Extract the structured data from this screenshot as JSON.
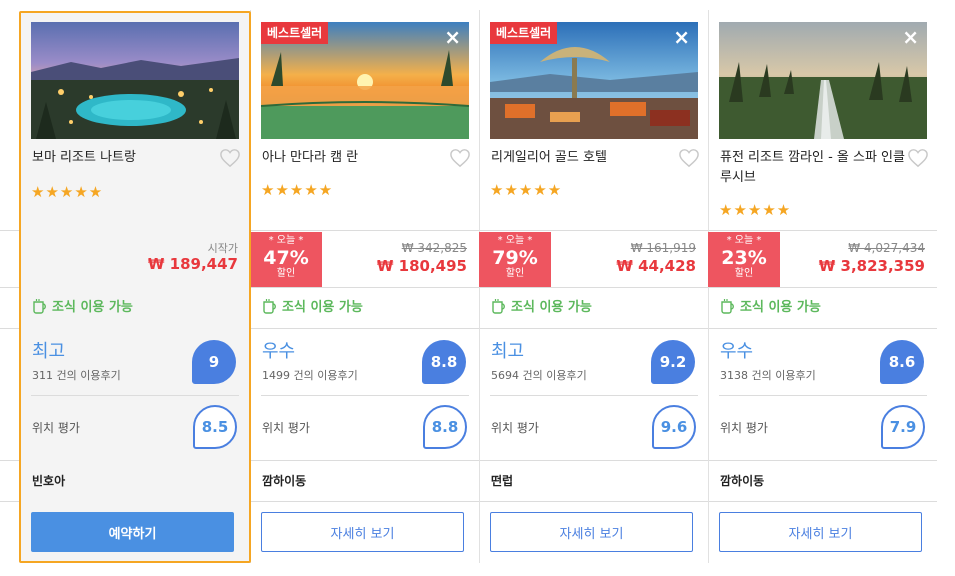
{
  "hotels": [
    {
      "name": "보마 리조트 나트랑",
      "stars": "★★★★★",
      "price_label": "시작가",
      "price": "₩ 189,447",
      "breakfast": "조식 이용 가능",
      "score_word": "최고",
      "reviews": "311 건의 이용후기",
      "score": "9",
      "location_label": "위치 평가",
      "location_score": "8.5",
      "area": "빈호아",
      "button": "예약하기"
    },
    {
      "name": "아나 만다라 캠 란",
      "badge": "베스트셀러",
      "stars": "★★★★★",
      "deal_today": "* 오늘 *",
      "deal_pct": "47%",
      "deal_off": "할인",
      "old_price": "₩ 342,825",
      "price": "₩ 180,495",
      "breakfast": "조식 이용 가능",
      "score_word": "우수",
      "reviews": "1499 건의 이용후기",
      "score": "8.8",
      "location_label": "위치 평가",
      "location_score": "8.8",
      "area": "깜하이동",
      "button": "자세히 보기"
    },
    {
      "name": "리게일리어 골드 호텔",
      "badge": "베스트셀러",
      "stars": "★★★★★",
      "deal_today": "* 오늘 *",
      "deal_pct": "79%",
      "deal_off": "할인",
      "old_price": "₩ 161,919",
      "price": "₩ 44,428",
      "breakfast": "조식 이용 가능",
      "score_word": "최고",
      "reviews": "5694 건의 이용후기",
      "score": "9.2",
      "location_label": "위치 평가",
      "location_score": "9.6",
      "area": "떤럽",
      "button": "자세히 보기"
    },
    {
      "name": "퓨전 리조트 깜라인 - 올 스파 인클루시브",
      "stars": "★★★★★",
      "deal_today": "* 오늘 *",
      "deal_pct": "23%",
      "deal_off": "할인",
      "old_price": "₩ 4,027,434",
      "price": "₩ 3,823,359",
      "breakfast": "조식 이용 가능",
      "score_word": "우수",
      "reviews": "3138 건의 이용후기",
      "score": "8.6",
      "location_label": "위치 평가",
      "location_score": "7.9",
      "area": "깜하이동",
      "button": "자세히 보기"
    }
  ],
  "colors": {
    "accent_blue": "#4a90e2",
    "price_red": "#e8383d",
    "star_orange": "#f5a623",
    "breakfast_green": "#5cb85c",
    "selected_border": "#f5a623"
  },
  "icons": {
    "close": "×",
    "heart": "heart-outline-icon",
    "cup": "coffee-cup-icon"
  }
}
